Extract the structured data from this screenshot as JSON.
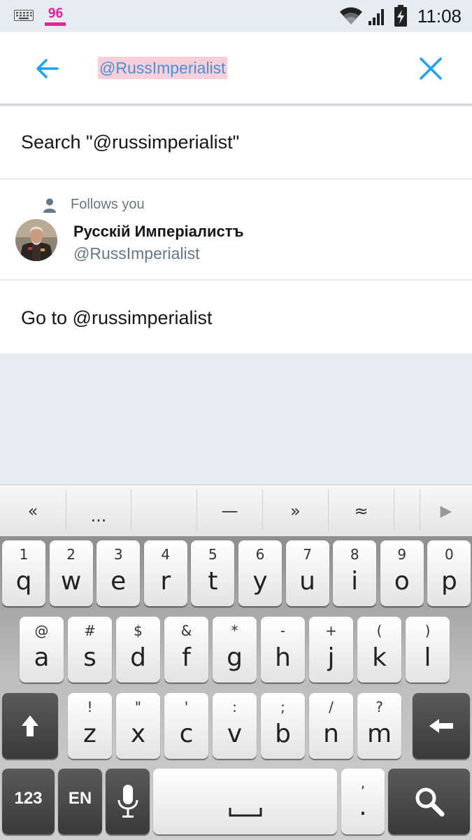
{
  "status_bar": {
    "notification_badge": "96",
    "time": "11:08",
    "icons": [
      "keyboard-icon",
      "badge-96-icon",
      "wifi-icon",
      "signal-icon",
      "battery-charging-icon"
    ]
  },
  "search": {
    "query": "@RussImperialist",
    "back_icon": "arrow-left-icon",
    "clear_icon": "close-icon",
    "accent_color": "#1da1f2"
  },
  "results": {
    "search_suggestion": "Search \"@russimperialist\"",
    "user": {
      "follows_label": "Follows you",
      "name": "Русскій Имперіалистъ",
      "handle": "@RussImperialist"
    },
    "goto": "Go to @russimperialist"
  },
  "keyboard": {
    "suggestions": [
      "«",
      "...",
      "",
      "—",
      "»",
      "≈",
      "",
      "▶"
    ],
    "row1": [
      {
        "hint": "1",
        "key": "q"
      },
      {
        "hint": "2",
        "key": "w"
      },
      {
        "hint": "3",
        "key": "e"
      },
      {
        "hint": "4",
        "key": "r"
      },
      {
        "hint": "5",
        "key": "t"
      },
      {
        "hint": "6",
        "key": "y"
      },
      {
        "hint": "7",
        "key": "u"
      },
      {
        "hint": "8",
        "key": "i"
      },
      {
        "hint": "9",
        "key": "o"
      },
      {
        "hint": "0",
        "key": "p"
      }
    ],
    "row2": [
      {
        "hint": "@",
        "key": "a"
      },
      {
        "hint": "#",
        "key": "s"
      },
      {
        "hint": "$",
        "key": "d"
      },
      {
        "hint": "&",
        "key": "f"
      },
      {
        "hint": "*",
        "key": "g"
      },
      {
        "hint": "-",
        "key": "h"
      },
      {
        "hint": "+",
        "key": "j"
      },
      {
        "hint": "(",
        "key": "k"
      },
      {
        "hint": ")",
        "key": "l"
      }
    ],
    "row3": [
      {
        "hint": "!",
        "key": "z"
      },
      {
        "hint": "\"",
        "key": "x"
      },
      {
        "hint": "'",
        "key": "c"
      },
      {
        "hint": ":",
        "key": "v"
      },
      {
        "hint": ";",
        "key": "b"
      },
      {
        "hint": "/",
        "key": "n"
      },
      {
        "hint": "?",
        "key": "m"
      }
    ],
    "numbers_label": "123",
    "language_label": "EN",
    "punct_hint": ",",
    "punct_key": "."
  }
}
